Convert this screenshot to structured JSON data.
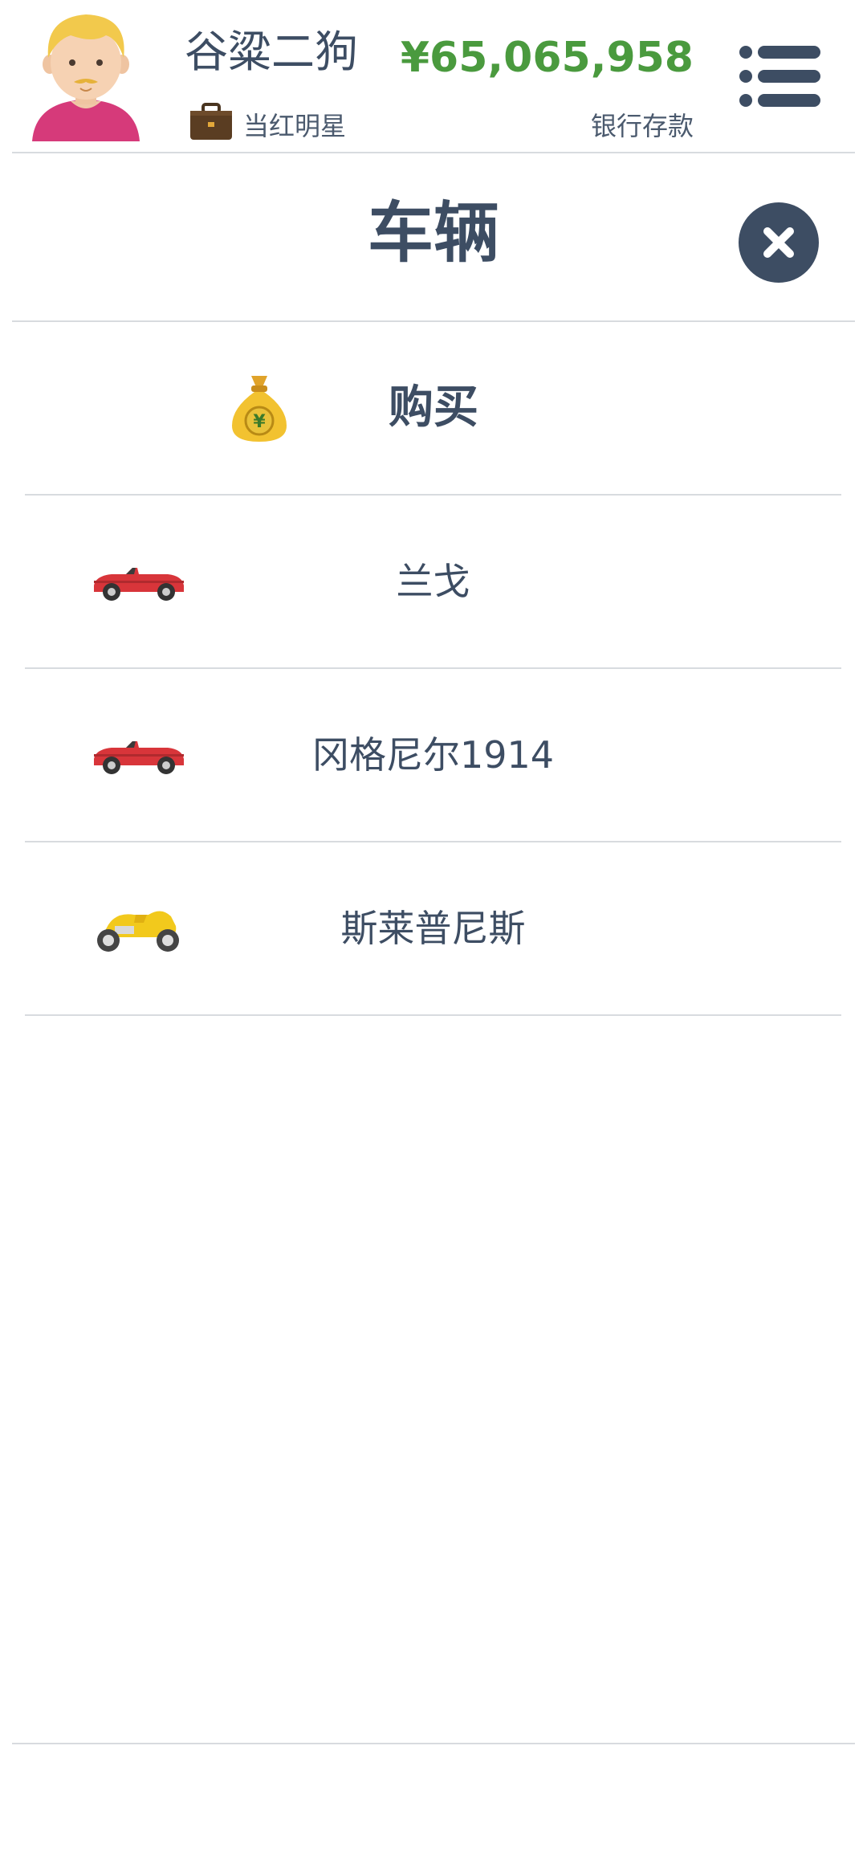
{
  "header": {
    "player_name": "谷粱二狗",
    "job": "当红明星",
    "money": "¥65,065,958",
    "money_label": "银行存款"
  },
  "page": {
    "title": "车辆"
  },
  "list": {
    "buy_label": "购买",
    "vehicles": [
      {
        "name": "兰戈",
        "icon": "red-convertible-icon"
      },
      {
        "name": "冈格尼尔1914",
        "icon": "red-convertible-icon"
      },
      {
        "name": "斯莱普尼斯",
        "icon": "yellow-motorcycle-icon"
      }
    ]
  },
  "colors": {
    "text": "#3d4d63",
    "money": "#4a9a3e",
    "divider": "#d8dbdf",
    "close_button": "#3d4d63"
  }
}
